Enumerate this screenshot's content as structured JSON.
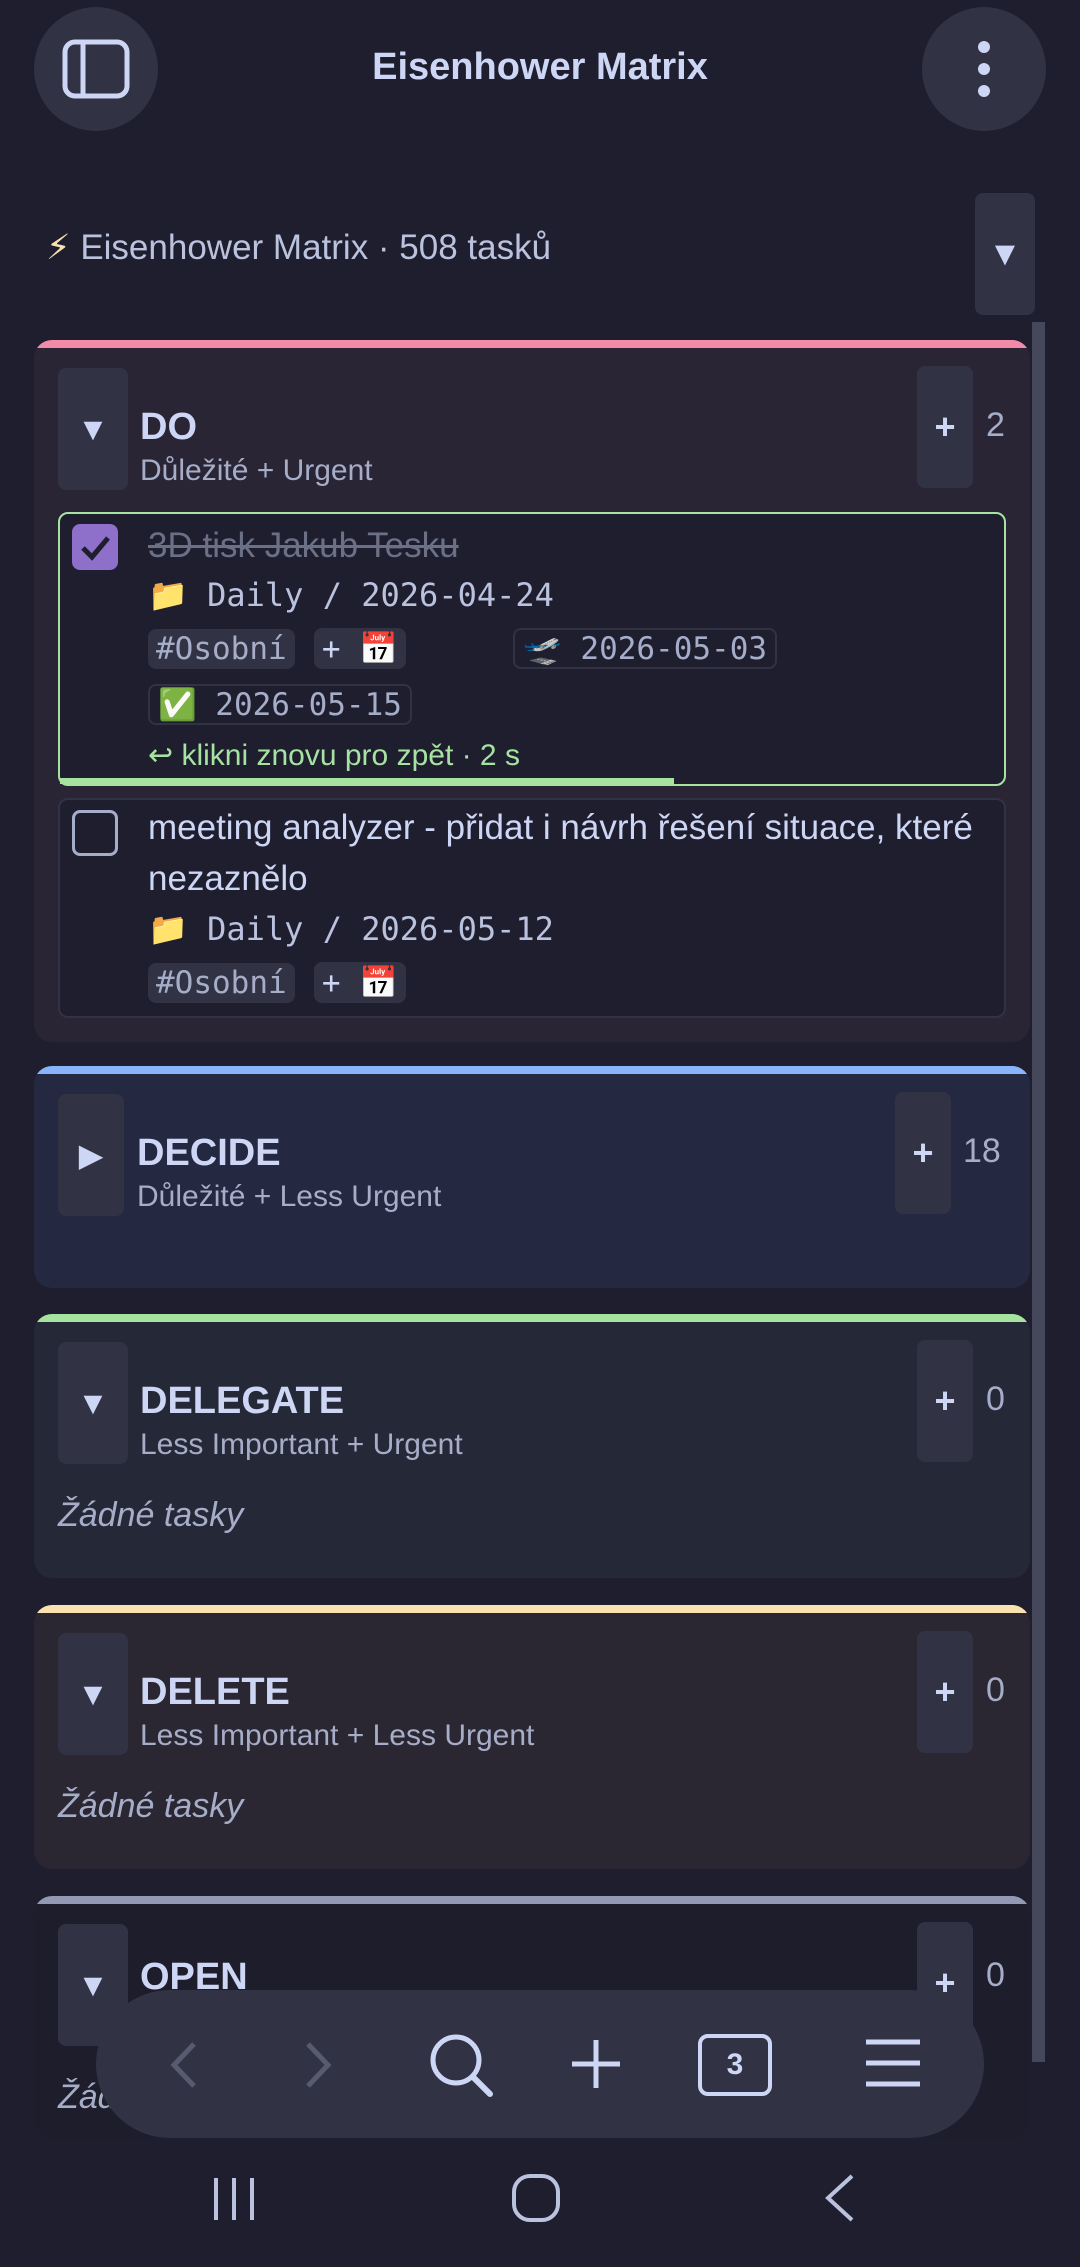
{
  "header": {
    "title": "Eisenhower Matrix",
    "sidebar_icon": "sidebar-toggle-icon",
    "more_icon": "more-vertical-icon"
  },
  "view": {
    "bolt": "⚡",
    "label": "Eisenhower Matrix · 508 tasků",
    "dropdown": "▼"
  },
  "quadrants": [
    {
      "name": "DO",
      "subtitle": "Důležité + Urgent",
      "count": "2",
      "expanded": true,
      "accent": "#f38ba8",
      "toggle": "▼",
      "tasks": [
        {
          "title": "3D tisk Jakub Tesku",
          "checked": true,
          "folder_icon": "📁",
          "path": "Daily / 2026-04-24",
          "tag": "#Osobní",
          "add_date": "+ 📅",
          "scheduled_icon": "🛫",
          "scheduled": "2026-05-03",
          "done_icon": "✅",
          "done": "2026-05-15",
          "undo_text": "↩ klikni znovu pro zpět · 2 s",
          "undo_progress": 0.65
        },
        {
          "title": "meeting analyzer - přidat i návrh řešení situace, které nezaznělo",
          "checked": false,
          "folder_icon": "📁",
          "path": "Daily / 2026-05-12",
          "tag": "#Osobní",
          "add_date": "+ 📅"
        }
      ]
    },
    {
      "name": "DECIDE",
      "subtitle": "Důležité + Less Urgent",
      "count": "18",
      "expanded": false,
      "accent": "#89b4fa",
      "toggle": "▶"
    },
    {
      "name": "DELEGATE",
      "subtitle": "Less Important + Urgent",
      "count": "0",
      "expanded": true,
      "accent": "#a6e3a1",
      "toggle": "▼",
      "empty": "Žádné tasky"
    },
    {
      "name": "DELETE",
      "subtitle": "Less Important + Less Urgent",
      "count": "0",
      "expanded": true,
      "accent": "#f9e2af",
      "toggle": "▼",
      "empty": "Žádné tasky"
    },
    {
      "name": "OPEN",
      "count": "0",
      "expanded": true,
      "accent": "#9399b2",
      "toggle": "▼",
      "empty": "Žád"
    }
  ],
  "add_symbol": "+",
  "browser_bar": {
    "tabs_count": "3"
  }
}
